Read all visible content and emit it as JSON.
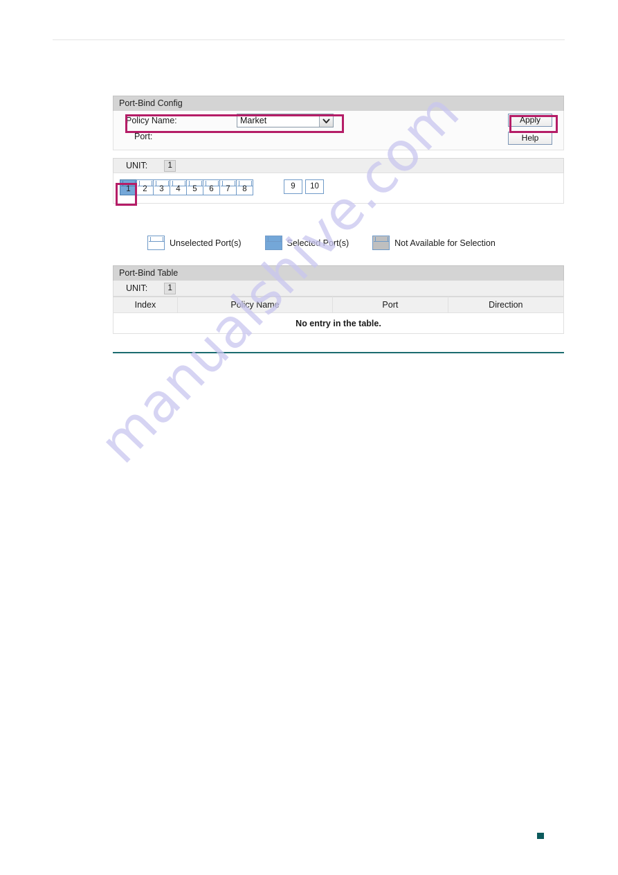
{
  "page": {
    "watermark": "manualshive.com",
    "accent_teal": "#1b6b6f",
    "highlight_magenta": "#b51d67",
    "selected_port_blue": "#74a7d8",
    "unavailable_gray": "#bfbfbf"
  },
  "config": {
    "title": "Port-Bind Config",
    "policy_label": "Policy Name:",
    "policy_value": "Market",
    "policy_options": [
      "Market"
    ],
    "port_label": "Port:",
    "apply_label": "Apply",
    "help_label": "Help"
  },
  "ports": {
    "unit_label": "UNIT:",
    "unit_value": "1",
    "rj45": [
      {
        "num": "1",
        "state": "selected"
      },
      {
        "num": "2",
        "state": "unselected"
      },
      {
        "num": "3",
        "state": "unselected"
      },
      {
        "num": "4",
        "state": "unselected"
      },
      {
        "num": "5",
        "state": "unselected"
      },
      {
        "num": "6",
        "state": "unselected"
      },
      {
        "num": "7",
        "state": "unselected"
      },
      {
        "num": "8",
        "state": "unselected"
      }
    ],
    "sfp": [
      {
        "num": "9",
        "state": "unselected"
      },
      {
        "num": "10",
        "state": "unselected"
      }
    ]
  },
  "legend": [
    {
      "label": "Unselected Port(s)",
      "state": "unselected"
    },
    {
      "label": "Selected Port(s)",
      "state": "selected"
    },
    {
      "label": "Not Available for Selection",
      "state": "unavailable"
    }
  ],
  "table": {
    "title": "Port-Bind Table",
    "unit_label": "UNIT:",
    "unit_value": "1",
    "columns": [
      "Index",
      "Policy Name",
      "Port",
      "Direction"
    ],
    "empty_message": "No entry in the table."
  }
}
